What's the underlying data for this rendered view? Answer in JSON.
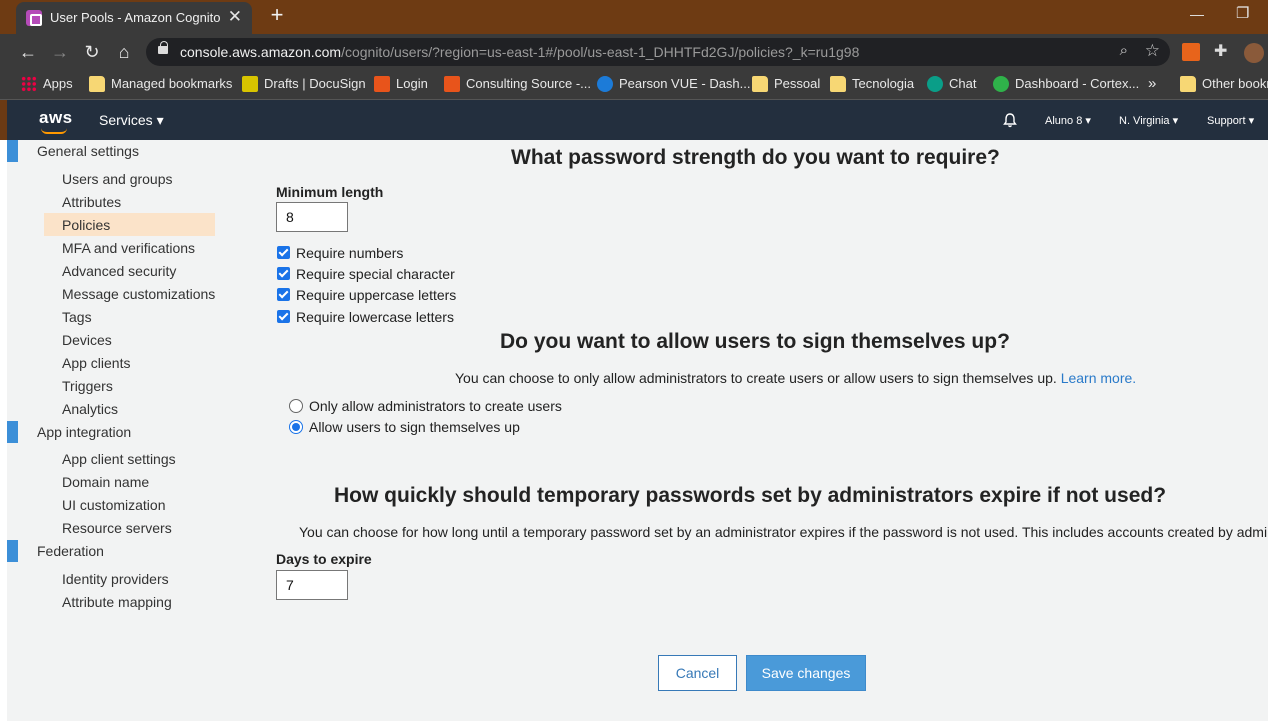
{
  "browser": {
    "tab_title": "User Pools - Amazon Cognito",
    "url_host": "console.aws.amazon.com",
    "url_path": "/cognito/users/?region=us-east-1#/pool/us-east-1_DHHTFd2GJ/policies?_k=ru1g98",
    "bookmarks": [
      "Apps",
      "Managed bookmarks",
      "Drafts | DocuSign",
      "Login",
      "Consulting Source -...",
      "Pearson VUE - Dash...",
      "Pessoal",
      "Tecnologia",
      "Chat",
      "Dashboard - Cortex...",
      "Other bookm"
    ]
  },
  "aws_header": {
    "logo": "aws",
    "services": "Services ▾",
    "user": "Aluno 8 ▾",
    "region": "N. Virginia ▾",
    "support": "Support ▾"
  },
  "sidebar": {
    "general_settings": {
      "title": "General settings",
      "items": [
        "Users and groups",
        "Attributes",
        "Policies",
        "MFA and verifications",
        "Advanced security",
        "Message customizations",
        "Tags",
        "Devices",
        "App clients",
        "Triggers",
        "Analytics"
      ]
    },
    "app_integration": {
      "title": "App integration",
      "items": [
        "App client settings",
        "Domain name",
        "UI customization",
        "Resource servers"
      ]
    },
    "federation": {
      "title": "Federation",
      "items": [
        "Identity providers",
        "Attribute mapping"
      ]
    },
    "active_item": "Policies"
  },
  "password": {
    "heading": "What password strength do you want to require?",
    "min_length_label": "Minimum length",
    "min_length_value": "8",
    "checks": [
      "Require numbers",
      "Require special character",
      "Require uppercase letters",
      "Require lowercase letters"
    ]
  },
  "signup": {
    "heading": "Do you want to allow users to sign themselves up?",
    "description": "You can choose to only allow administrators to create users or allow users to sign themselves up.",
    "learn_more": "Learn more.",
    "option_admin": "Only allow administrators to create users",
    "option_self": "Allow users to sign themselves up",
    "selected": "option_self"
  },
  "expiry": {
    "heading": "How quickly should temporary passwords set by administrators expire if not used?",
    "description": "You can choose for how long until a temporary password set by an administrator expires if the password is not used. This includes accounts created by administrators.",
    "days_label": "Days to expire",
    "days_value": "7"
  },
  "actions": {
    "cancel": "Cancel",
    "save": "Save changes"
  },
  "colors": {
    "aws_header": "#232f3e",
    "accent": "#1a73e8",
    "primary_button": "#4a9ad9",
    "active_nav": "#fbe3c9",
    "sidebar_marker": "#3c8fd8"
  }
}
